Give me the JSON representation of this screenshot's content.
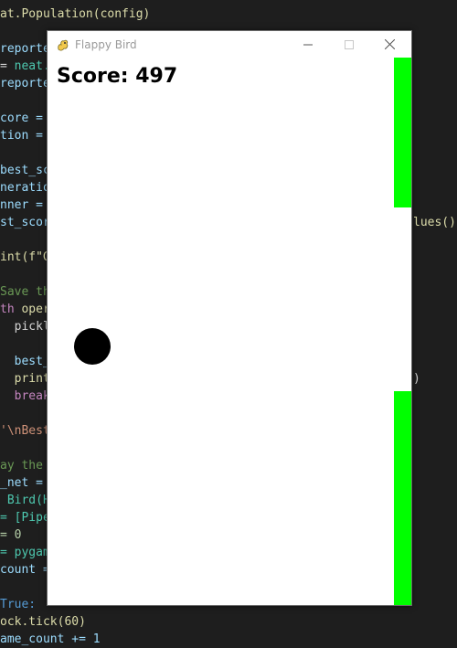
{
  "editor": {
    "lines": [
      [
        {
          "t": "at.Population(config)",
          "c": "#dcdcaa"
        }
      ],
      [],
      [
        {
          "t": "reporte",
          "c": "#9cdcfe"
        }
      ],
      [
        {
          "t": "= ",
          "c": "#d4d4d4"
        },
        {
          "t": "neat.",
          "c": "#4ec9b0"
        }
      ],
      [
        {
          "t": "reporte",
          "c": "#9cdcfe"
        }
      ],
      [],
      [
        {
          "t": "core =",
          "c": "#9cdcfe"
        }
      ],
      [
        {
          "t": "tion =",
          "c": "#9cdcfe"
        }
      ],
      [],
      [
        {
          "t": "best_sc",
          "c": "#9cdcfe"
        }
      ],
      [
        {
          "t": "neratio",
          "c": "#9cdcfe"
        }
      ],
      [
        {
          "t": "nner =",
          "c": "#9cdcfe"
        }
      ],
      [
        {
          "t": "st_scor",
          "c": "#9cdcfe"
        }
      ],
      [],
      [
        {
          "t": "int(f\"G",
          "c": "#dcdcaa"
        }
      ],
      [],
      [
        {
          "t": "Save th",
          "c": "#6a9955"
        }
      ],
      [
        {
          "t": "th ",
          "c": "#c586c0"
        },
        {
          "t": "oper",
          "c": "#dcdcaa"
        }
      ],
      [
        {
          "t": "  pickl",
          "c": "#d4d4d4"
        }
      ],
      [],
      [
        {
          "t": "  best_s",
          "c": "#9cdcfe"
        }
      ],
      [
        {
          "t": "  print",
          "c": "#dcdcaa"
        }
      ],
      [
        {
          "t": "  break",
          "c": "#c586c0"
        }
      ],
      [],
      [
        {
          "t": "'\\nBest",
          "c": "#ce9178"
        }
      ],
      [],
      [
        {
          "t": "ay the",
          "c": "#6a9955"
        }
      ],
      [
        {
          "t": "_net =",
          "c": "#9cdcfe"
        }
      ],
      [
        {
          "t": " Bird(H",
          "c": "#4ec9b0"
        }
      ],
      [
        {
          "t": "= [Pipe",
          "c": "#4ec9b0"
        }
      ],
      [
        {
          "t": "= 0",
          "c": "#b5cea8"
        }
      ],
      [
        {
          "t": "= pygam",
          "c": "#4ec9b0"
        }
      ],
      [
        {
          "t": "count =",
          "c": "#9cdcfe"
        }
      ],
      [],
      [
        {
          "t": "True:",
          "c": "#569cd6"
        }
      ],
      [
        {
          "t": "ock.tick(60)",
          "c": "#dcdcaa"
        }
      ],
      [
        {
          "t": "ame_count += 1",
          "c": "#9cdcfe"
        }
      ]
    ],
    "right_fragments": [
      {
        "line": 12,
        "text": "lues()",
        "color": "#dcdcaa"
      },
      {
        "line": 21,
        "text": ")",
        "color": "#d4d4d4"
      }
    ]
  },
  "window": {
    "title": "Flappy Bird",
    "controls": {
      "minimize_icon": "minimize-icon",
      "maximize_icon": "maximize-icon",
      "close_icon": "close-icon"
    }
  },
  "game": {
    "score_label": "Score: 497",
    "colors": {
      "background": "#ffffff",
      "pipe": "#00ff00",
      "bird": "#000000"
    }
  }
}
